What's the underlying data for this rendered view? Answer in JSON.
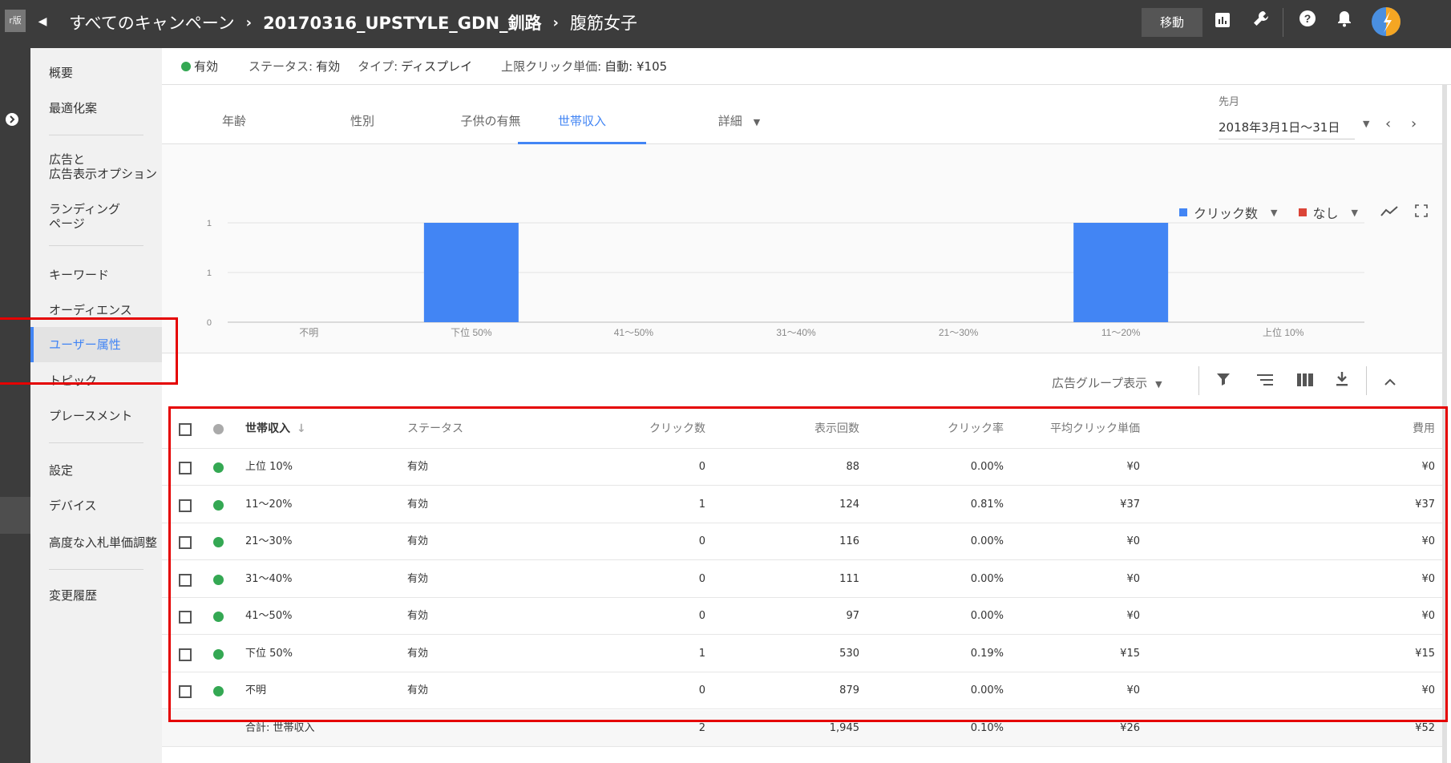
{
  "topbar": {
    "badge": "r版",
    "breadcrumb": [
      "すべてのキャンペーン",
      "20170316_UPSTYLE_GDN_釧路",
      "腹筋女子"
    ],
    "move_label": "移動"
  },
  "sidenav": {
    "items": [
      {
        "label": "概要"
      },
      {
        "label": "最適化案"
      },
      {
        "label": "広告と\n広告表示オプション"
      },
      {
        "label": "ランディング\nページ"
      },
      {
        "label": "キーワード"
      },
      {
        "label": "オーディエンス"
      },
      {
        "label": "ユーザー属性"
      },
      {
        "label": "トピック"
      },
      {
        "label": "プレースメント"
      },
      {
        "label": "設定"
      },
      {
        "label": "デバイス"
      },
      {
        "label": "高度な入札単価調整"
      },
      {
        "label": "変更履歴"
      }
    ]
  },
  "status": {
    "state": "有効",
    "status_label": "ステータス:",
    "status_value": "有効",
    "type_label": "タイプ:",
    "type_value": "ディスプレイ",
    "cpc_label": "上限クリック単価:",
    "cpc_value": "自動: ¥105"
  },
  "tabs": [
    {
      "label": "年齢"
    },
    {
      "label": "性別"
    },
    {
      "label": "子供の有無"
    },
    {
      "label": "世帯収入"
    },
    {
      "label": "詳細"
    }
  ],
  "date": {
    "period_label": "先月",
    "range": "2018年3月1日〜31日"
  },
  "metrics": [
    {
      "label": "クリック数",
      "color": "#4285f4"
    },
    {
      "label": "なし",
      "color": "#db4437"
    }
  ],
  "chart_data": {
    "type": "bar",
    "categories": [
      "不明",
      "下位 50%",
      "41〜50%",
      "31〜40%",
      "21〜30%",
      "11〜20%",
      "上位 10%"
    ],
    "values": [
      0,
      1,
      0,
      0,
      0,
      1,
      0
    ],
    "ytick_labels": [
      "1",
      "1",
      "0"
    ],
    "ylim": [
      0,
      1
    ],
    "bar_color": "#4285f4",
    "grid": true
  },
  "toolbar": {
    "view_label": "広告グループ表示"
  },
  "table": {
    "headers": {
      "name": "世帯収入",
      "status": "ステータス",
      "clicks": "クリック数",
      "impressions": "表示回数",
      "ctr": "クリック率",
      "avg_cpc": "平均クリック単価",
      "cost": "費用"
    },
    "rows": [
      {
        "name": "上位 10%",
        "status": "有効",
        "clicks": "0",
        "impressions": "88",
        "ctr": "0.00%",
        "avg_cpc": "¥0",
        "cost": "¥0"
      },
      {
        "name": "11〜20%",
        "status": "有効",
        "clicks": "1",
        "impressions": "124",
        "ctr": "0.81%",
        "avg_cpc": "¥37",
        "cost": "¥37"
      },
      {
        "name": "21〜30%",
        "status": "有効",
        "clicks": "0",
        "impressions": "116",
        "ctr": "0.00%",
        "avg_cpc": "¥0",
        "cost": "¥0"
      },
      {
        "name": "31〜40%",
        "status": "有効",
        "clicks": "0",
        "impressions": "111",
        "ctr": "0.00%",
        "avg_cpc": "¥0",
        "cost": "¥0"
      },
      {
        "name": "41〜50%",
        "status": "有効",
        "clicks": "0",
        "impressions": "97",
        "ctr": "0.00%",
        "avg_cpc": "¥0",
        "cost": "¥0"
      },
      {
        "name": "下位 50%",
        "status": "有効",
        "clicks": "1",
        "impressions": "530",
        "ctr": "0.19%",
        "avg_cpc": "¥15",
        "cost": "¥15"
      },
      {
        "name": "不明",
        "status": "有効",
        "clicks": "0",
        "impressions": "879",
        "ctr": "0.00%",
        "avg_cpc": "¥0",
        "cost": "¥0"
      }
    ],
    "total": {
      "name": "合計: 世帯収入",
      "clicks": "2",
      "impressions": "1,945",
      "ctr": "0.10%",
      "avg_cpc": "¥26",
      "cost": "¥52"
    }
  }
}
